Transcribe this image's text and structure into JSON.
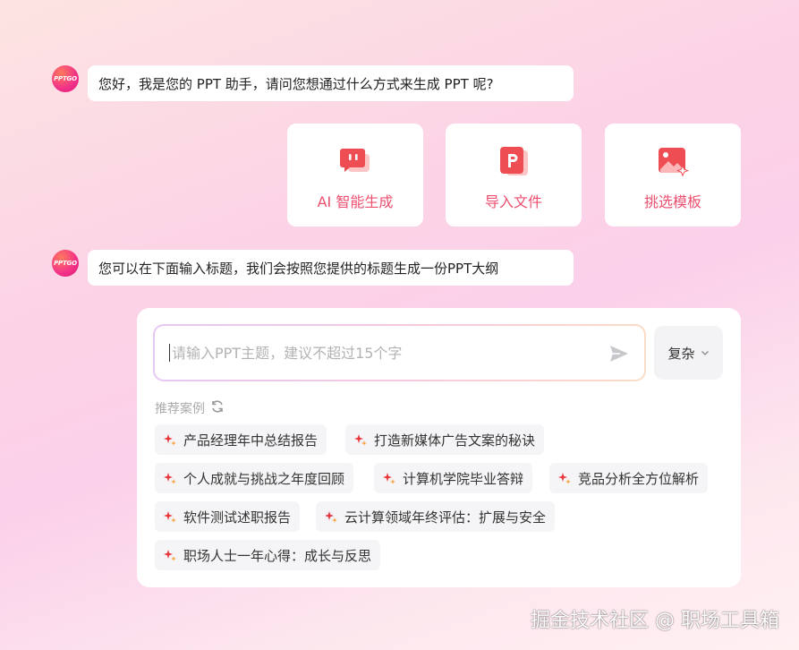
{
  "assistant": {
    "avatar_text": "PPTGO",
    "greeting": "您好，我是您的 PPT 助手，请问您想通过什么方式来生成 PPT 呢?",
    "instruction": "您可以在下面输入标题，我们会按照您提供的标题生成一份PPT大纲"
  },
  "options": [
    {
      "label": "AI 智能生成",
      "icon": "ai-chat-icon"
    },
    {
      "label": "导入文件",
      "icon": "ppt-file-icon"
    },
    {
      "label": "挑选模板",
      "icon": "template-image-icon"
    }
  ],
  "input": {
    "value": "",
    "placeholder": "请输入PPT主题，建议不超过15个字"
  },
  "mode_select": {
    "selected": "复杂",
    "icon": "chevron-down-icon"
  },
  "recommend": {
    "title": "推荐案例",
    "refresh_icon": "refresh-icon",
    "items": [
      "产品经理年中总结报告",
      "打造新媒体广告文案的秘诀",
      "个人成就与挑战之年度回顾",
      "计算机学院毕业答辩",
      "竞品分析全方位解析",
      "软件测试述职报告",
      "云计算领域年终评估：扩展与安全",
      "职场人士一年心得：成长与反思"
    ]
  },
  "watermark": "掘金技术社区 @ 职场工具箱",
  "colors": {
    "accent": "#ec4f6f",
    "spark_red": "#e8383d",
    "spark_orange": "#f7a23b"
  }
}
